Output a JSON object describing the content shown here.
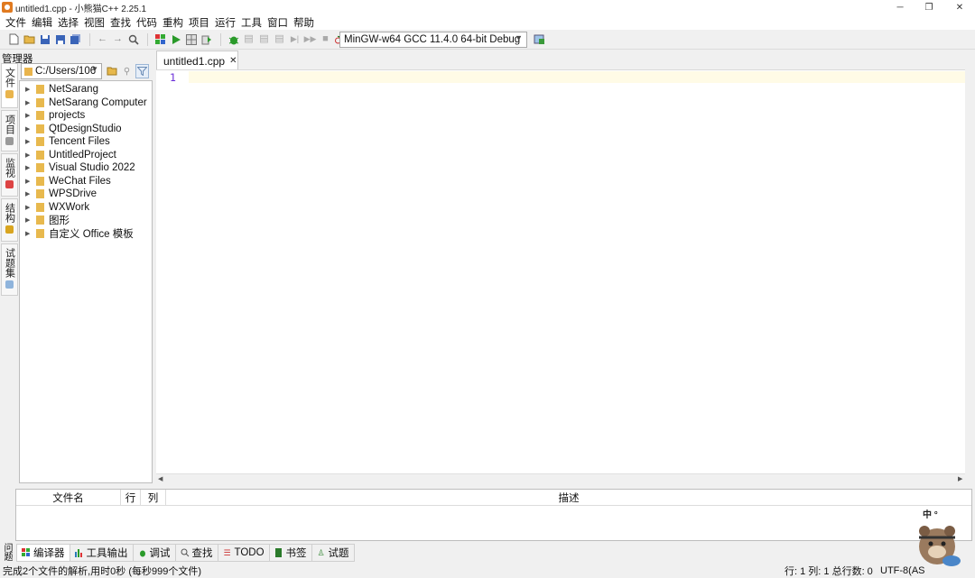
{
  "window": {
    "title": "untitled1.cpp - 小熊猫C++ 2.25.1",
    "controls": [
      "─",
      "❐",
      "✕"
    ]
  },
  "menu": [
    "文件",
    "编辑",
    "选择",
    "视图",
    "查找",
    "代码",
    "重构",
    "项目",
    "运行",
    "工具",
    "窗口",
    "帮助"
  ],
  "toolbar": {
    "compiler": "MinGW-w64 GCC 11.4.0 64-bit Debug",
    "icons": [
      "new-file",
      "open",
      "save",
      "save-as",
      "save-all",
      "undo",
      "redo",
      "find",
      "compile",
      "run",
      "compile-run",
      "rebuild",
      "debug",
      "step",
      "step-into",
      "step-out",
      "continue",
      "stop",
      "profile",
      "options"
    ]
  },
  "manager": {
    "label": "管理器",
    "path": "C:/Users/106",
    "items": [
      "NetSarang",
      "NetSarang Computer",
      "projects",
      "QtDesignStudio",
      "Tencent Files",
      "UntitledProject",
      "Visual Studio 2022",
      "WeChat Files",
      "WPSDrive",
      "WXWork",
      "图形",
      "自定义 Office 模板"
    ]
  },
  "side_tabs": [
    "文件",
    "项目",
    "监视",
    "结构",
    "试题集"
  ],
  "editor": {
    "tab": "untitled1.cpp",
    "line_number": "1"
  },
  "messages": {
    "columns": [
      "文件名",
      "行",
      "列",
      "描述"
    ]
  },
  "bottom_tabs": [
    "编译器",
    "工具输出",
    "调试",
    "查找",
    "TODO",
    "书签",
    "试题"
  ],
  "bottom_side_label": "问题",
  "status": {
    "left": "完成2个文件的解析,用时0秒 (每秒999个文件)",
    "position": "行: 1 列: 1 总行数: 0",
    "encoding": "UTF-8(AS"
  },
  "mascot_text": "中 °"
}
